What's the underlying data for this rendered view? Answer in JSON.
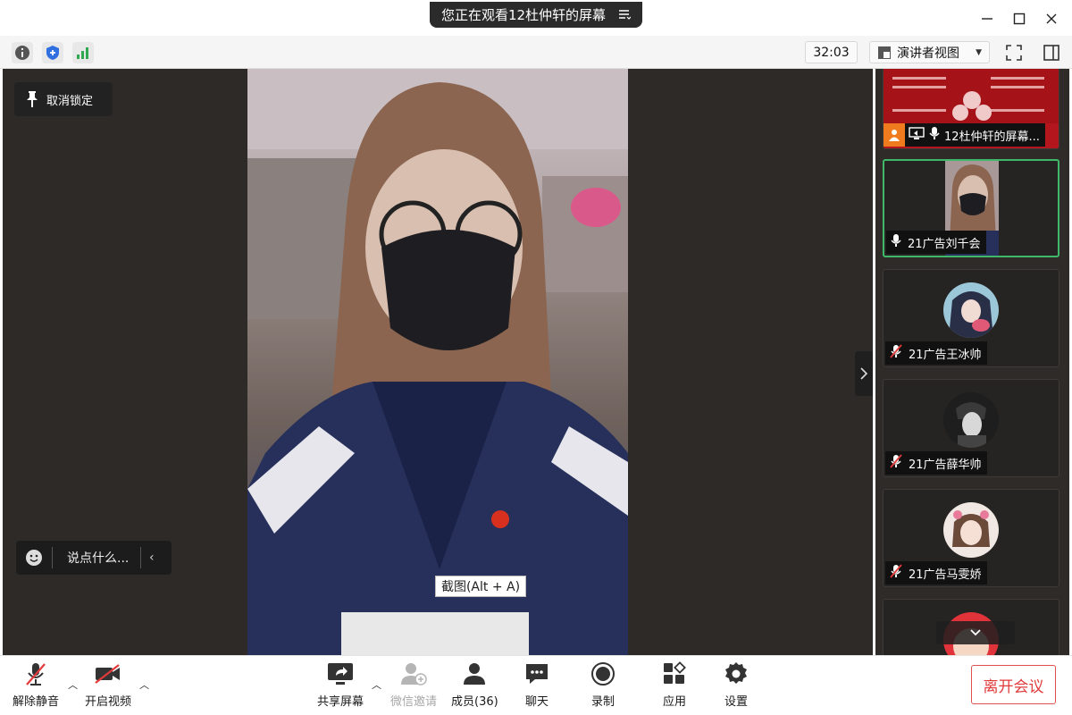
{
  "titlebar": {
    "share_banner": "您正在观看12杜仲轩的屏幕",
    "share_menu_icon": "list-icon",
    "minimize_icon": "minimize-icon",
    "maximize_icon": "maximize-icon",
    "close_icon": "close-icon"
  },
  "toolbar": {
    "info_icon": "info-icon",
    "security_icon": "shield-icon",
    "signal_icon": "signal-icon",
    "timer": "32:03",
    "view_mode": "演讲者视图",
    "fullscreen_icon": "fullscreen-icon",
    "panel_toggle_icon": "panel-icon"
  },
  "main": {
    "unlock_label": "取消锁定",
    "say_placeholder": "说点什么...",
    "tooltip": "截图(Alt + A)"
  },
  "participants": [
    {
      "name": "12杜仲轩的屏幕...",
      "muted": false,
      "sharing": true
    },
    {
      "name": "21广告刘千会",
      "muted": false,
      "active": true
    },
    {
      "name": "21广告王冰帅",
      "muted": true
    },
    {
      "name": "21广告薛华帅",
      "muted": true
    },
    {
      "name": "21广告马雯娇",
      "muted": true
    }
  ],
  "bottombar": {
    "unmute": "解除静音",
    "start_video": "开启视频",
    "share_screen": "共享屏幕",
    "wechat_invite": "微信邀请",
    "members": "成员(36)",
    "chat": "聊天",
    "record": "录制",
    "apps": "应用",
    "settings": "设置",
    "leave": "离开会议"
  },
  "colors": {
    "accent_green": "#3fb86a",
    "leave_red": "#e03a3a",
    "dark_bg": "#2d2a28"
  }
}
